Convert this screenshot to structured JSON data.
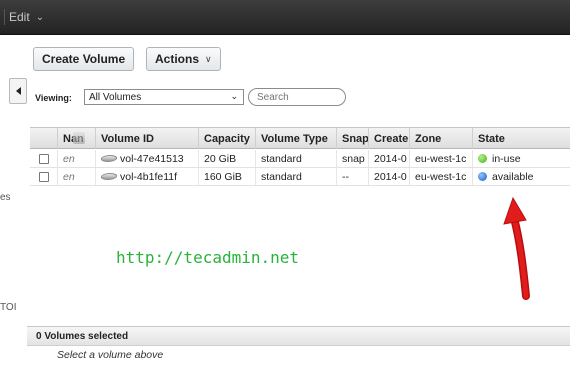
{
  "topbar": {
    "edit_label": "Edit"
  },
  "sidebar": {
    "fragment_1": "es",
    "fragment_2": "TOI"
  },
  "toolbar": {
    "create_label": "Create Volume",
    "actions_label": "Actions"
  },
  "filter": {
    "viewing_label": "Viewing:",
    "viewing_value": "All Volumes",
    "search_placeholder": "Search"
  },
  "table": {
    "headers": [
      "Nan",
      "Volume ID",
      "Capacity",
      "Volume Type",
      "Snap",
      "Create",
      "Zone",
      "State"
    ],
    "rows": [
      {
        "name": "en",
        "volume_id": "vol-47e41513",
        "capacity": "20 GiB",
        "type": "standard",
        "snapshot": "snap",
        "created": "2014-0",
        "zone": "eu-west-1c",
        "state": "in-use"
      },
      {
        "name": "en",
        "volume_id": "vol-4b1fe11f",
        "capacity": "160 GiB",
        "type": "standard",
        "snapshot": "--",
        "created": "2014-0",
        "zone": "eu-west-1c",
        "state": "available"
      }
    ]
  },
  "watermark": "http://tecadmin.net",
  "status": {
    "selected_text": "0 Volumes selected",
    "hint": "Select a volume above"
  },
  "colors": {
    "in_use": "#3fae1a",
    "available": "#1b5cc6",
    "arrow": "#e21b1b"
  }
}
